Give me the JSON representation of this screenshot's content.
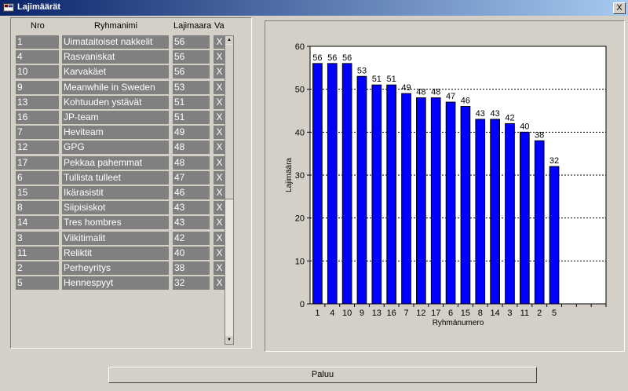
{
  "window": {
    "title": "Lajimäärät",
    "close_label": "X"
  },
  "table": {
    "headers": {
      "nro": "Nro",
      "name": "Ryhmanimi",
      "lajimaara": "Lajimaara",
      "va": "Va"
    },
    "rows": [
      {
        "nro": "1",
        "name": "Uimataitoiset nakkelit",
        "lajimaara": "56",
        "x": "X"
      },
      {
        "nro": "4",
        "name": "Rasvaniskat",
        "lajimaara": "56",
        "x": "X"
      },
      {
        "nro": "10",
        "name": "Karvakäet",
        "lajimaara": "56",
        "x": "X"
      },
      {
        "nro": "9",
        "name": "Meanwhile in Sweden",
        "lajimaara": "53",
        "x": "X"
      },
      {
        "nro": "13",
        "name": "Kohtuuden ystävät",
        "lajimaara": "51",
        "x": "X"
      },
      {
        "nro": "16",
        "name": "JP-team",
        "lajimaara": "51",
        "x": "X"
      },
      {
        "nro": "7",
        "name": "Heviteam",
        "lajimaara": "49",
        "x": "X"
      },
      {
        "nro": "12",
        "name": "GPG",
        "lajimaara": "48",
        "x": "X"
      },
      {
        "nro": "17",
        "name": "Pekkaa pahemmat",
        "lajimaara": "48",
        "x": "X"
      },
      {
        "nro": "6",
        "name": "Tullista tulleet",
        "lajimaara": "47",
        "x": "X"
      },
      {
        "nro": "15",
        "name": "Ikärasistit",
        "lajimaara": "46",
        "x": "X"
      },
      {
        "nro": "8",
        "name": "Siipisiskot",
        "lajimaara": "43",
        "x": "X"
      },
      {
        "nro": "14",
        "name": "Tres hombres",
        "lajimaara": "43",
        "x": "X"
      },
      {
        "nro": "3",
        "name": "Viikitimalit",
        "lajimaara": "42",
        "x": "X"
      },
      {
        "nro": "11",
        "name": "Reliktit",
        "lajimaara": "40",
        "x": "X"
      },
      {
        "nro": "2",
        "name": "Perheyritys",
        "lajimaara": "38",
        "x": "X"
      },
      {
        "nro": "5",
        "name": "Hennespyyt",
        "lajimaara": "32",
        "x": "X"
      }
    ]
  },
  "chart_data": {
    "type": "bar",
    "categories": [
      "1",
      "4",
      "10",
      "9",
      "13",
      "16",
      "7",
      "12",
      "17",
      "6",
      "15",
      "8",
      "14",
      "3",
      "11",
      "2",
      "5"
    ],
    "values": [
      56,
      56,
      56,
      53,
      51,
      51,
      49,
      48,
      48,
      47,
      46,
      43,
      43,
      42,
      40,
      38,
      32
    ],
    "xlabel": "Ryhmänumero",
    "ylabel": "Lajimäära",
    "ylim": [
      0,
      60
    ],
    "yticks": [
      0,
      10,
      20,
      30,
      40,
      50,
      60
    ],
    "empty_slots": 3,
    "bar_color": "#0000ff",
    "grid": "horizontal dashed",
    "data_labels": true
  },
  "buttons": {
    "paluu": "Paluu"
  },
  "colors": {
    "face": "#d4d0c8",
    "cell": "#808080",
    "title_start": "#0a246a",
    "title_end": "#a6caf0"
  }
}
